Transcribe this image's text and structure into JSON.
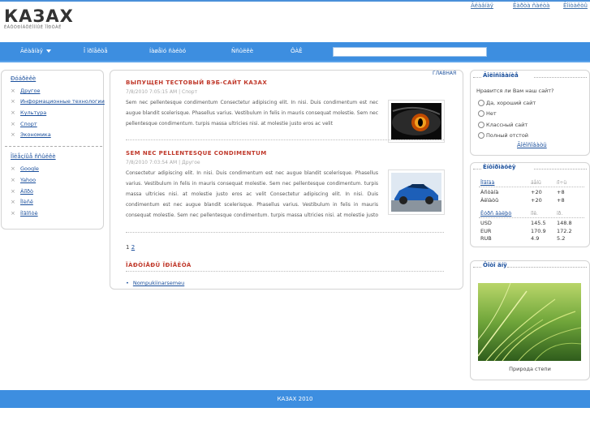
{
  "header": {
    "logo": "КАЗАХ",
    "logo_sub": "ÈÁÔÓÐÌÀÖÈÎÍÍÛÉ ÏÎÐÒÀË",
    "top_links": [
      "Ãëàâíàÿ",
      "Êàðòà ñàéòà",
      "Êîíòàêòû"
    ]
  },
  "nav": {
    "items": [
      "Ãëàâíàÿ",
      "Î ïðîåêòå",
      "Íàøåìó ñàéòó",
      "Ññûëêè",
      "ÔÀÊ"
    ],
    "search_value": ""
  },
  "left": {
    "title1": "Ðóáðèêè",
    "categories": [
      "Другое",
      "Информационные технологии",
      "Культура",
      "Спорт",
      "Экономика"
    ],
    "title2": "Ïîëåçíûå ññûëêè",
    "links": [
      "Google",
      "Yahoo",
      "Àïîðò",
      "Ïîèñê",
      "Íîâîñòè"
    ]
  },
  "main": {
    "breadcrumb": "ГЛАВНАЯ",
    "posts": [
      {
        "title": "ВЫПУЩЕН ТЕСТОВЫЙ ВЭБ-САЙТ КАЗАХ",
        "meta": "7/8/2010 7:05:15 AM | Спорт",
        "body": "Sem nec pellentesque condimentum Consectetur adipiscing elit. In nisi. Duis condimentum est nec augue blandit scelerisque. Phasellus varius. Vestibulum in felis in mauris consequat molestie. Sem nec pellentesque condimentum. turpis massa ultricies nisi. at molestie justo eros ac velit"
      },
      {
        "title": "SEM NEC PELLENTESQUE CONDIMENTUM",
        "meta": "7/8/2010 7:03:54 AM | Другое",
        "body": "Consectetur adipiscing elit. In nisi. Duis condimentum est nec augue blandit scelerisque. Phasellus varius. Vestibulum in felis in mauris consequat molestie. Sem nec pellentesque condimentum. turpis massa ultricies nisi. at molestie justo eros ac velit Consectetur adipiscing elit. In nisi. Duis condimentum est nec augue blandit scelerisque. Phasellus varius. Vestibulum in felis in mauris consequat molestie. Sem nec pellentesque condimentum. turpis massa ultricies nisi. at molestie justo eros ac velit"
      }
    ],
    "pages": [
      "1",
      "2"
    ],
    "partners_title": "ÏÀÐÒÍÅÐÛ ÏÐÎÅÊÒÀ",
    "partners": [
      "Nompukiinarsemeu"
    ]
  },
  "poll": {
    "title": "Ãîëîñîâàíèå",
    "question": "Нравится ли Вам наш сайт?",
    "options": [
      "Да, хороший сайт",
      "Нет",
      "Классный сайт",
      "Полный отстой"
    ],
    "vote": "Ãîëîñîâàòü"
  },
  "info": {
    "title": "Èíôîðìàöèÿ",
    "weather_head": "Ïîãîäà",
    "weather_cols": [
      "äåíü",
      "íî÷ü"
    ],
    "weather": [
      {
        "city": "Àñòàíà",
        "day": "+20",
        "night": "+8"
      },
      {
        "city": "Àëìàòû",
        "day": "+20",
        "night": "+8"
      }
    ],
    "currency_head": "Êóðñ âàëþò",
    "currency_cols": [
      "ïîê.",
      "ïð."
    ],
    "currency": [
      {
        "code": "USD",
        "buy": "145.5",
        "sell": "148.8"
      },
      {
        "code": "EUR",
        "buy": "170.9",
        "sell": "172.2"
      },
      {
        "code": "RUB",
        "buy": "4.9",
        "sell": "5.2"
      }
    ]
  },
  "photo": {
    "title": "Ôîòî äíÿ",
    "caption": "Природа степи"
  },
  "footer": {
    "text": "КАЗАХ 2010"
  }
}
